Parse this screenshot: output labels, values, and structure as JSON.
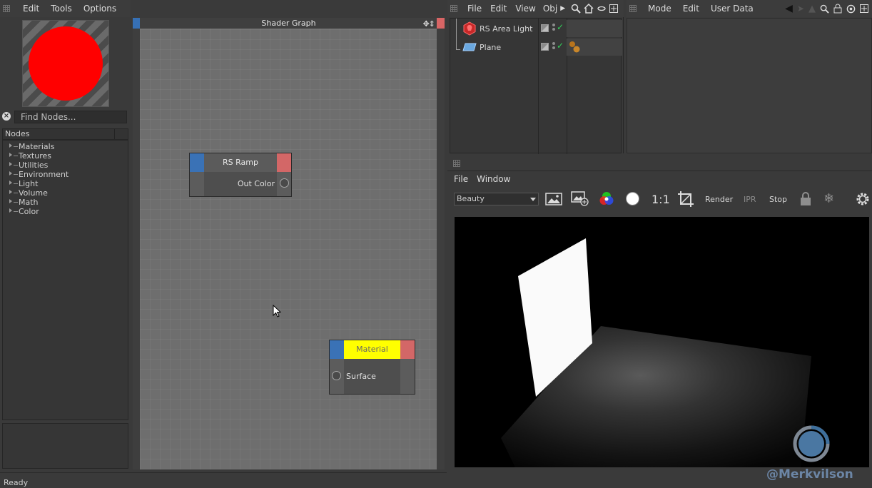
{
  "left_panel": {
    "menu": [
      "Edit",
      "Tools",
      "Options"
    ],
    "find_placeholder": "Find Nodes...",
    "nodes_header": "Nodes",
    "tree": [
      "Materials",
      "Textures",
      "Utilities",
      "Environment",
      "Light",
      "Volume",
      "Math",
      "Color"
    ],
    "status": "Ready"
  },
  "shader_graph": {
    "title": "Shader Graph",
    "nodes": [
      {
        "title": "RS Ramp",
        "port_label": "Out Color"
      },
      {
        "title": "Material",
        "port_label": "Surface"
      }
    ]
  },
  "object_manager": {
    "menu": [
      "File",
      "Edit",
      "View",
      "Obj"
    ],
    "objects": [
      {
        "name": "RS Area Light",
        "icon": "area-light-icon"
      },
      {
        "name": "Plane",
        "icon": "plane-icon"
      }
    ]
  },
  "attribute_manager": {
    "menu": [
      "Mode",
      "Edit",
      "User Data"
    ]
  },
  "render_view": {
    "menu": [
      "File",
      "Window"
    ],
    "aov": "Beauty",
    "ratio_label": "1:1",
    "render_label": "Render",
    "ipr_label": "IPR",
    "stop_label": "Stop"
  },
  "watermark": "@Merkvilson",
  "colors": {
    "preview_ball": "#ff0000",
    "node_blue": "#3a72b6",
    "node_red": "#d36767",
    "material_header": "#ffff00"
  }
}
